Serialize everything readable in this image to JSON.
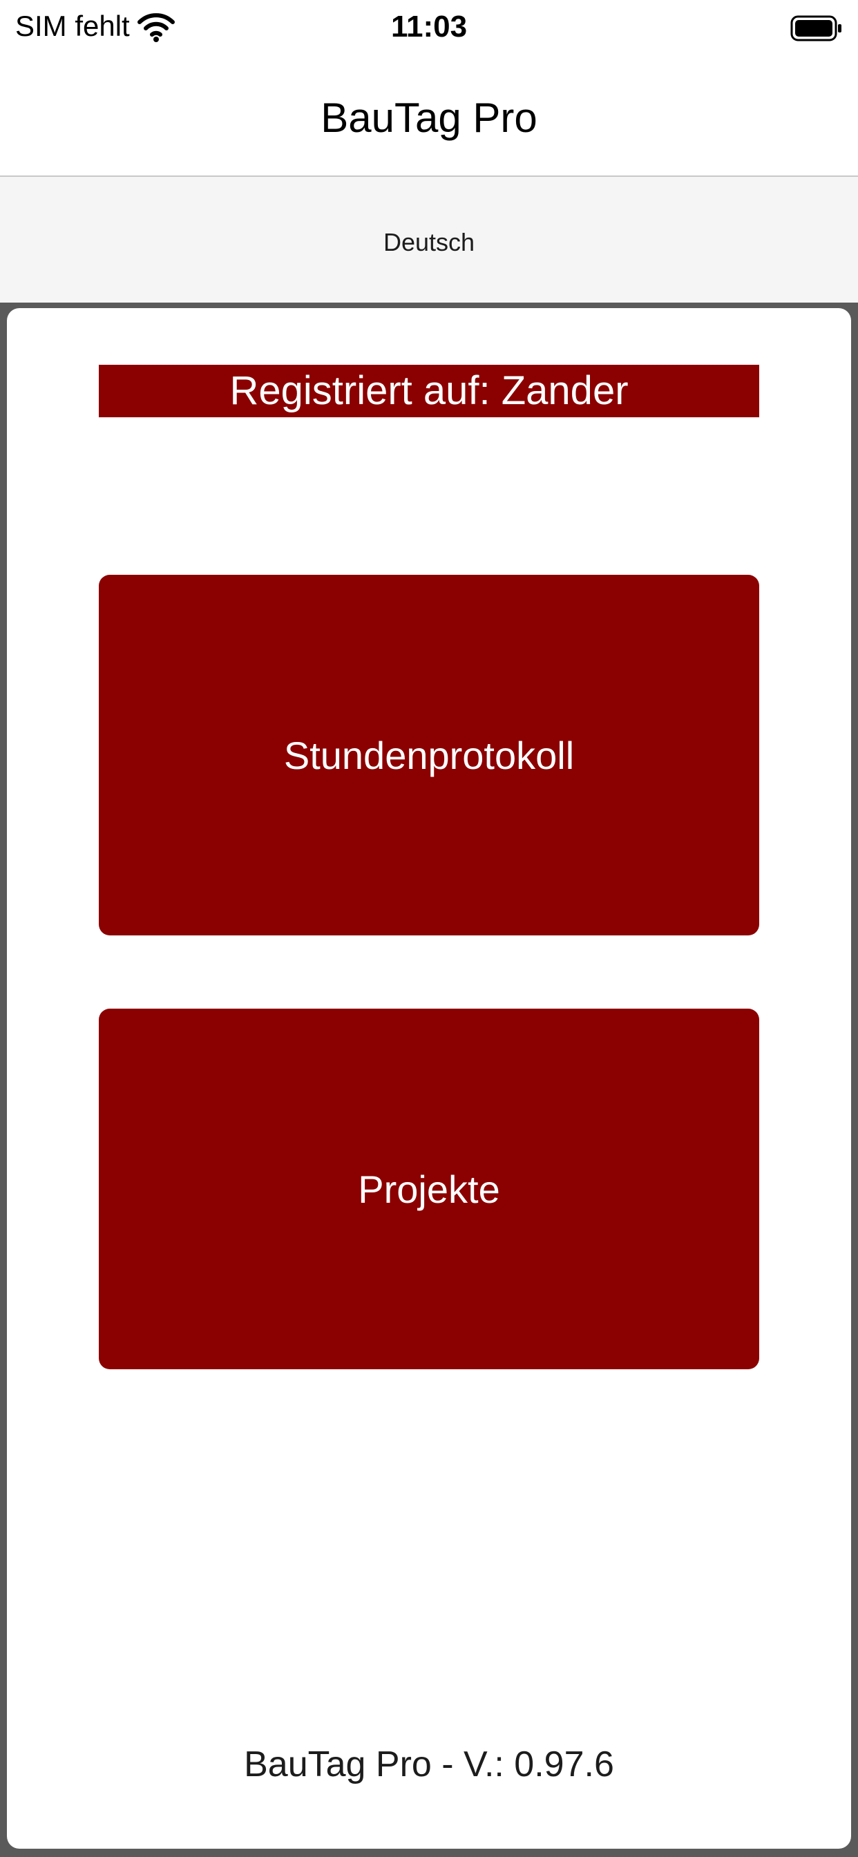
{
  "status_bar": {
    "carrier": "SIM fehlt",
    "time": "11:03",
    "wifi_icon": "wifi-icon",
    "battery_icon": "battery-full-icon"
  },
  "header": {
    "title": "BauTag Pro"
  },
  "language": {
    "label": "Deutsch"
  },
  "main": {
    "registered_label": "Registriert auf: Zander",
    "buttons": [
      {
        "label": "Stundenprotokoll"
      },
      {
        "label": "Projekte"
      }
    ],
    "version": "BauTag Pro - V.: 0.97.6"
  },
  "colors": {
    "accent": "#8b0000",
    "backdrop": "#5a5a5a",
    "lang_bar": "#f5f5f5"
  }
}
